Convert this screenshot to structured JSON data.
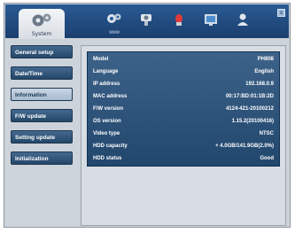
{
  "header": {
    "active_tab_label": "System",
    "active_tab_icon": "gears-icon",
    "icons": [
      {
        "name": "network-settings-icon",
        "label": "WWW"
      },
      {
        "name": "camera-icon",
        "label": ""
      },
      {
        "name": "alarm-icon",
        "label": ""
      },
      {
        "name": "recording-icon",
        "label": ""
      },
      {
        "name": "user-icon",
        "label": ""
      }
    ],
    "close_label": "x"
  },
  "sidebar": {
    "items": [
      {
        "label": "General setup",
        "active": false
      },
      {
        "label": "Date/Time",
        "active": false
      },
      {
        "label": "Information",
        "active": true
      },
      {
        "label": "F/W update",
        "active": false
      },
      {
        "label": "Setting update",
        "active": false
      },
      {
        "label": "Initialization",
        "active": false
      }
    ]
  },
  "info": {
    "rows": [
      {
        "key": "Model",
        "value": "PH808"
      },
      {
        "key": "Language",
        "value": "English"
      },
      {
        "key": "IP address",
        "value": "192.168.0.9"
      },
      {
        "key": "MAC address",
        "value": "00:17:BD:01:1B:2D"
      },
      {
        "key": "F/W version",
        "value": "4124-421-20100212"
      },
      {
        "key": "OS version",
        "value": "1.15.2(20100416)"
      },
      {
        "key": "Video type",
        "value": "NTSC"
      },
      {
        "key": "HDD capacity",
        "value": "+ 4.0GB/141.9GB(2.0%)"
      },
      {
        "key": "HDD status",
        "value": "Good"
      }
    ]
  },
  "colors": {
    "topbar": "#1f4a7d",
    "sidebar_button": "#2f5478",
    "info_panel": "#2f5478",
    "panel_bg": "#d7dde3"
  }
}
